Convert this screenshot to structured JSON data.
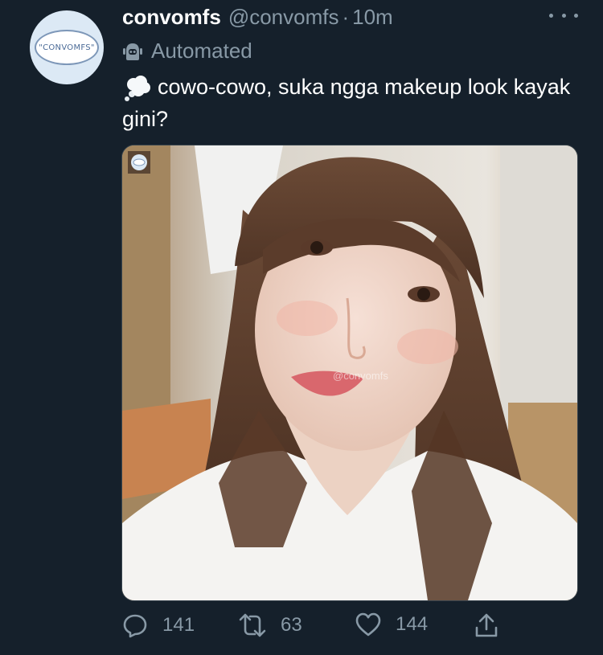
{
  "tweet": {
    "display_name": "convomfs",
    "handle": "@convomfs",
    "separator": "·",
    "time": "10m",
    "automated_label": "Automated",
    "text": "cowo-cowo, suka ngga makeup look kayak gini?",
    "text_emoji": "thought-balloon",
    "avatar_text": "\"CONVOMFS\"",
    "image_watermark": "@convomfs"
  },
  "actions": {
    "replies": "141",
    "retweets": "63",
    "likes": "144"
  },
  "icons": [
    "more-icon",
    "robot-icon",
    "thought-balloon-icon",
    "reply-icon",
    "retweet-icon",
    "like-icon",
    "share-icon"
  ],
  "colors": {
    "background": "#15202b",
    "primary_text": "#ffffff",
    "secondary_text": "#8899a6",
    "border": "#38444d"
  }
}
